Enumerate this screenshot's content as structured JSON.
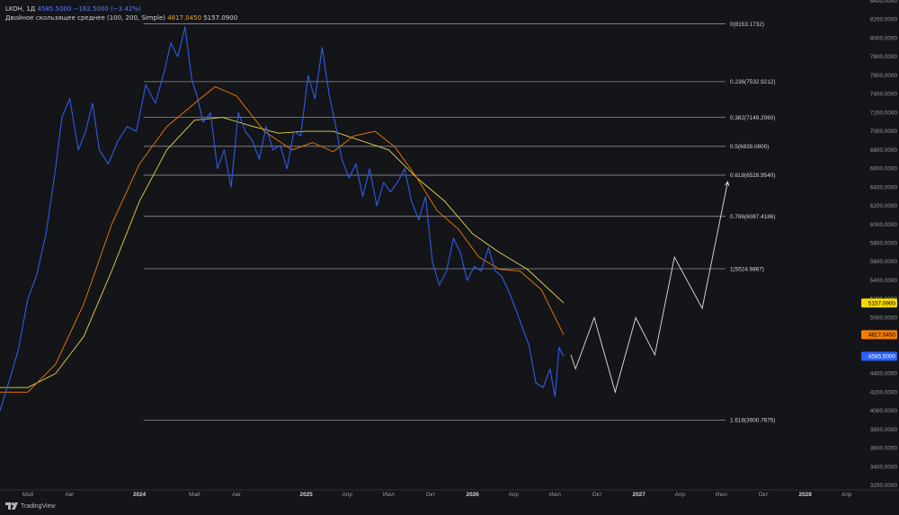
{
  "legend": {
    "symbol": "LKOH, 1Д",
    "price": "4585.5000",
    "change": "−162.5000 (−3.42%)",
    "indicator": "Двойное скользящее среднее (100, 200, Simple)",
    "ma_fast_value": "4817.0450",
    "ma_slow_value": "5157.0900"
  },
  "branding": {
    "logo_text": "TradingView"
  },
  "colors": {
    "background": "#141518",
    "price": "#2f5bea",
    "ma_fast": "#f57c00",
    "ma_slow": "#e8d44d",
    "fib": "#8a8f99",
    "projection": "#e0e0e0"
  },
  "chart_data": {
    "type": "line",
    "symbol": "LKOH",
    "timeframe": "1Д",
    "ylim": [
      3200,
      8400
    ],
    "y_ticks": [
      3200,
      3400,
      3600,
      3800,
      4000,
      4200,
      4400,
      4600,
      4800,
      5000,
      5200,
      5400,
      5600,
      5800,
      6000,
      6200,
      6400,
      6600,
      6800,
      7000,
      7200,
      7400,
      7600,
      7800,
      8000,
      8200,
      8400
    ],
    "y_tick_format": "0000.0000",
    "x_tick_labels": [
      "Май",
      "Авг",
      "2024",
      "Май",
      "Авг",
      "2025",
      "Апр",
      "Июл",
      "Окт",
      "2026",
      "Апр",
      "Июл",
      "Окт",
      "2027",
      "Апр",
      "Июл",
      "Окт",
      "2028",
      "Апр"
    ],
    "x_tick_dates": [
      "2023-05-01",
      "2023-08-01",
      "2024-01-01",
      "2024-05-01",
      "2024-08-01",
      "2025-01-01",
      "2025-04-01",
      "2025-07-01",
      "2025-10-01",
      "2026-01-01",
      "2026-04-01",
      "2026-07-01",
      "2026-10-01",
      "2027-01-01",
      "2027-04-01",
      "2027-07-01",
      "2027-10-01",
      "2028-01-01",
      "2028-04-01"
    ],
    "xlim": [
      "2023-03-01",
      "2028-05-01"
    ],
    "series": [
      {
        "name": "LKOH",
        "x": [
          "2023-03-01",
          "2023-03-20",
          "2023-04-10",
          "2023-05-01",
          "2023-05-20",
          "2023-06-10",
          "2023-07-01",
          "2023-07-15",
          "2023-08-01",
          "2023-08-20",
          "2023-09-05",
          "2023-09-20",
          "2023-10-05",
          "2023-10-25",
          "2023-11-15",
          "2023-12-05",
          "2023-12-25",
          "2024-01-15",
          "2024-02-05",
          "2024-02-25",
          "2024-03-10",
          "2024-03-25",
          "2024-04-10",
          "2024-04-25",
          "2024-05-05",
          "2024-05-20",
          "2024-06-05",
          "2024-06-20",
          "2024-07-05",
          "2024-07-20",
          "2024-08-05",
          "2024-08-20",
          "2024-09-05",
          "2024-09-20",
          "2024-10-05",
          "2024-10-20",
          "2024-11-05",
          "2024-11-20",
          "2024-12-05",
          "2024-12-20",
          "2025-01-05",
          "2025-01-20",
          "2025-02-05",
          "2025-02-20",
          "2025-03-05",
          "2025-03-20",
          "2025-04-05",
          "2025-04-20",
          "2025-05-05",
          "2025-05-20",
          "2025-06-05",
          "2025-06-20",
          "2025-07-05",
          "2025-07-20",
          "2025-08-05",
          "2025-08-20",
          "2025-09-05",
          "2025-09-20",
          "2025-10-05",
          "2025-10-20",
          "2025-11-05",
          "2025-11-20",
          "2025-12-05",
          "2025-12-20",
          "2026-01-05",
          "2026-01-20",
          "2026-02-05",
          "2026-02-20",
          "2026-03-05",
          "2026-03-20",
          "2026-04-05",
          "2026-04-20",
          "2026-05-05",
          "2026-05-20",
          "2026-06-05",
          "2026-06-20",
          "2026-07-01",
          "2026-07-10",
          "2026-07-20"
        ],
        "values": [
          4000,
          4300,
          4650,
          5200,
          5450,
          5900,
          6600,
          7150,
          7350,
          6800,
          7000,
          7300,
          6800,
          6650,
          6900,
          7050,
          7000,
          7500,
          7300,
          7650,
          7950,
          7800,
          8120,
          7550,
          7400,
          7100,
          7200,
          6600,
          6800,
          6400,
          7200,
          7000,
          6900,
          6700,
          7050,
          6800,
          6850,
          6600,
          7000,
          6950,
          7600,
          7350,
          7900,
          7400,
          7100,
          6700,
          6500,
          6650,
          6300,
          6600,
          6200,
          6450,
          6350,
          6450,
          6600,
          6250,
          6050,
          6300,
          5600,
          5350,
          5500,
          5850,
          5700,
          5400,
          5550,
          5500,
          5750,
          5500,
          5450,
          5300,
          5100,
          4900,
          4700,
          4300,
          4250,
          4450,
          4150,
          4680,
          4585.5
        ]
      },
      {
        "name": "SMA 100",
        "x": [
          "2023-03-01",
          "2023-05-01",
          "2023-07-01",
          "2023-09-01",
          "2023-11-01",
          "2024-01-01",
          "2024-03-01",
          "2024-05-01",
          "2024-06-15",
          "2024-08-01",
          "2024-10-01",
          "2024-12-01",
          "2025-01-15",
          "2025-03-01",
          "2025-04-15",
          "2025-06-01",
          "2025-07-15",
          "2025-09-01",
          "2025-10-15",
          "2025-12-01",
          "2026-01-15",
          "2026-03-01",
          "2026-04-15",
          "2026-06-01",
          "2026-07-20"
        ],
        "values": [
          4200,
          4200,
          4500,
          5150,
          6000,
          6650,
          7050,
          7300,
          7480,
          7380,
          7000,
          6800,
          6880,
          6780,
          6950,
          7000,
          6830,
          6500,
          6150,
          5950,
          5650,
          5520,
          5500,
          5300,
          4817.045
        ]
      },
      {
        "name": "SMA 200",
        "x": [
          "2023-03-01",
          "2023-05-01",
          "2023-07-01",
          "2023-09-01",
          "2023-11-01",
          "2024-01-01",
          "2024-03-01",
          "2024-05-01",
          "2024-07-01",
          "2024-09-01",
          "2024-11-01",
          "2025-01-01",
          "2025-03-01",
          "2025-05-01",
          "2025-07-01",
          "2025-09-01",
          "2025-11-01",
          "2026-01-01",
          "2026-03-01",
          "2026-05-01",
          "2026-07-20"
        ],
        "values": [
          4250,
          4250,
          4400,
          4800,
          5500,
          6250,
          6800,
          7120,
          7150,
          7060,
          6980,
          7000,
          7000,
          6900,
          6800,
          6500,
          6250,
          5900,
          5700,
          5520,
          5157.09
        ]
      }
    ],
    "projection": {
      "x": [
        "2026-08-05",
        "2026-08-15",
        "2026-09-25",
        "2026-11-10",
        "2026-12-25",
        "2027-02-05",
        "2027-03-20",
        "2027-05-20",
        "2027-07-15"
      ],
      "values": [
        4600,
        4450,
        5000,
        4200,
        5000,
        4600,
        5650,
        5100,
        6460
      ]
    },
    "fib_levels": [
      {
        "label": "0(8153.1732)",
        "value": 8153.1732
      },
      {
        "label": "0.236(7532.9212)",
        "value": 7532.9212
      },
      {
        "label": "0.382(7149.2060)",
        "value": 7149.206
      },
      {
        "label": "0.5(6839.0800)",
        "value": 6839.08
      },
      {
        "label": "0.618(6528.9540)",
        "value": 6528.954
      },
      {
        "label": "0.786(6087.4186)",
        "value": 6087.4186
      },
      {
        "label": "1(5524.9867)",
        "value": 5524.9867
      },
      {
        "label": "1.618(3900.7675)",
        "value": 3900.7675
      }
    ],
    "fib_range_x": [
      "2024-01-10",
      "2027-12-31"
    ],
    "price_labels": [
      {
        "text": "5157.0900",
        "value": 5157.09,
        "color": "#f5d800",
        "text_color": "#000000"
      },
      {
        "text": "4817.0450",
        "value": 4817.045,
        "color": "#f57c00",
        "text_color": "#000000"
      },
      {
        "text": "4585.5000",
        "value": 4585.5,
        "color": "#2962ff",
        "text_color": "#ffffff"
      }
    ],
    "grid": false
  }
}
